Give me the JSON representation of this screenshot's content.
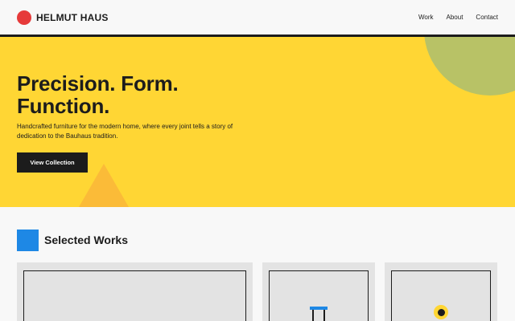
{
  "brand": {
    "name": "HELMUT HAUS",
    "accent": "#e63a3a"
  },
  "nav": {
    "items": [
      {
        "label": "Work"
      },
      {
        "label": "About"
      },
      {
        "label": "Contact"
      }
    ]
  },
  "hero": {
    "title_line1": "Precision. Form.",
    "title_line2": "Function.",
    "subtitle": "Handcrafted furniture for the modern home, where every joint tells a story of dedication to the Bauhaus tradition.",
    "cta_label": "View Collection",
    "background": "#ffd634"
  },
  "works": {
    "title": "Selected Works",
    "accent": "#1e88e5",
    "cards": 3
  }
}
